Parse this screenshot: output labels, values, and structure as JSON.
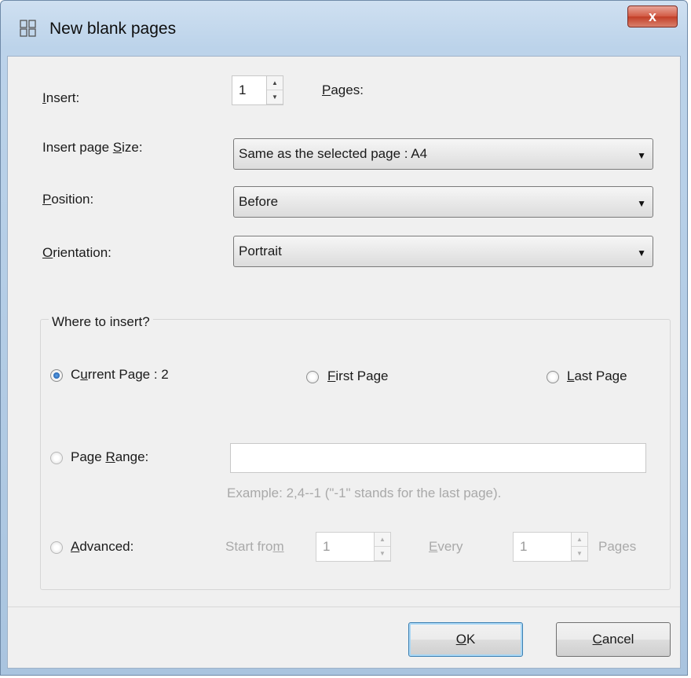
{
  "window": {
    "title": "New blank pages",
    "close_label": "x"
  },
  "insert": {
    "label": "Insert:",
    "value": "1",
    "pages_label": "Pages:"
  },
  "page_size": {
    "label": "Insert page Size:",
    "value": "Same as the selected page : A4"
  },
  "position": {
    "label": "Position:",
    "value": "Before"
  },
  "orientation": {
    "label": "Orientation:",
    "value": "Portrait"
  },
  "where": {
    "title": "Where to insert?",
    "current_page": "Current Page : 2",
    "first_page": "First Page",
    "last_page": "Last Page",
    "page_range": "Page Range:",
    "page_range_value": "",
    "example": "Example: 2,4--1 (\"-1\" stands for the last page).",
    "advanced": "Advanced:",
    "start_from_label": "Start from",
    "start_from_value": "1",
    "every_label": "Every",
    "every_value": "1",
    "pages_label": "Pages",
    "selected": "current_page"
  },
  "buttons": {
    "ok": "OK",
    "cancel": "Cancel"
  },
  "icons": {
    "app": "new-pages-icon",
    "spin_up": "spin-up-icon",
    "spin_down": "spin-down-icon",
    "dropdown": "chevron-down-icon"
  }
}
